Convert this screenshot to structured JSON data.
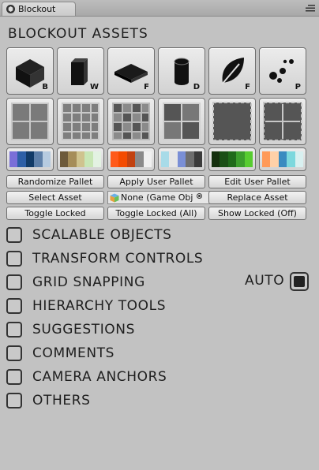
{
  "window": {
    "tab_title": "Blockout",
    "tab_icon": "unity-logo-icon",
    "menu_icon": "hamburger-menu-icon"
  },
  "panel": {
    "title": "BLOCKOUT ASSETS"
  },
  "asset_buttons": [
    {
      "icon": "block-icon",
      "letter": "B"
    },
    {
      "icon": "wall-icon",
      "letter": "W"
    },
    {
      "icon": "floor-icon",
      "letter": "F"
    },
    {
      "icon": "cylinder-icon",
      "letter": "D"
    },
    {
      "icon": "leaf-icon",
      "letter": "F"
    },
    {
      "icon": "particles-icon",
      "letter": "P"
    }
  ],
  "texture_buttons": [
    {
      "icon": "grid-2x2-texture-icon"
    },
    {
      "icon": "grid-4x4-texture-icon"
    },
    {
      "icon": "checker-texture-icon"
    },
    {
      "icon": "dark-grid-2x2-texture-icon"
    },
    {
      "icon": "solid-dark-texture-icon"
    },
    {
      "icon": "dark-cross-texture-icon"
    }
  ],
  "palette_buttons": [
    {
      "colors": [
        "#7a6fd8",
        "#2d5fa6",
        "#113a66",
        "#5d7fa8",
        "#b6cbe0"
      ]
    },
    {
      "colors": [
        "#6d5a3a",
        "#a58d59",
        "#cfc38e",
        "#c8e6b5",
        "#e3f2e2"
      ]
    },
    {
      "colors": [
        "#ff5a1a",
        "#f44b00",
        "#c24210",
        "#8a8a8a",
        "#f0f0f0"
      ]
    },
    {
      "colors": [
        "#a8dbe8",
        "#e6e6e6",
        "#7a8fd6",
        "#6e6e6e",
        "#3b3b3b"
      ]
    },
    {
      "colors": [
        "#14300e",
        "#1a4f16",
        "#1f6a1a",
        "#3b9e2c",
        "#57cc30"
      ]
    },
    {
      "colors": [
        "#ff9a59",
        "#ffd1a8",
        "#3a8bc0",
        "#7cd8dd",
        "#d8f0f0"
      ]
    }
  ],
  "actions": {
    "randomize_pallet": "Randomize Pallet",
    "apply_user_pallet": "Apply User Pallet",
    "edit_user_pallet": "Edit User Pallet",
    "select_asset": "Select Asset",
    "object_field_value": "None (Game Obj",
    "replace_asset": "Replace Asset",
    "toggle_locked": "Toggle Locked",
    "toggle_locked_all": "Toggle Locked (All)",
    "show_locked": "Show Locked (Off)"
  },
  "sections": [
    {
      "label": "SCALABLE OBJECTS",
      "checked": false
    },
    {
      "label": "TRANSFORM CONTROLS",
      "checked": false
    },
    {
      "label": "GRID SNAPPING",
      "checked": false
    },
    {
      "label": "HIERARCHY TOOLS",
      "checked": false
    },
    {
      "label": "SUGGESTIONS",
      "checked": false
    },
    {
      "label": "COMMENTS",
      "checked": false
    },
    {
      "label": "CAMERA ANCHORS",
      "checked": false
    },
    {
      "label": "OTHERS",
      "checked": false
    }
  ],
  "grid_snapping": {
    "auto_label": "AUTO",
    "auto_enabled": true
  }
}
